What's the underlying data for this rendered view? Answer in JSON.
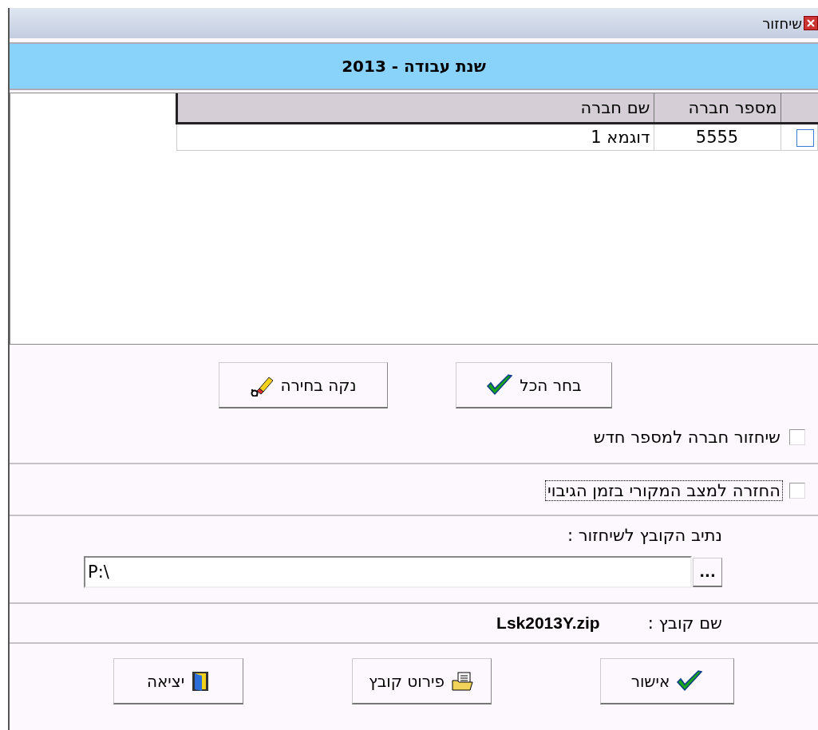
{
  "window": {
    "title": "שיחזור"
  },
  "header": {
    "title": "שנת עבודה - 2013"
  },
  "table": {
    "columns": [
      "מספר חברה",
      "שם חברה"
    ],
    "rows": [
      {
        "checked": false,
        "number": "5555",
        "name": "דוגמא 1"
      }
    ]
  },
  "selection_buttons": [
    {
      "kind": "select_all",
      "label": "בחר הכל"
    },
    {
      "kind": "clear",
      "label": "נקה בחירה"
    }
  ],
  "options": [
    {
      "label": "שיחזור חברה למספר חדש",
      "checked": false,
      "focused": false
    },
    {
      "label": "החזרה למצב המקורי בזמן הגיבוי",
      "checked": false,
      "focused": true
    }
  ],
  "path": {
    "label": "נתיב הקובץ לשיחזור :",
    "value": "P:\\",
    "browse_label": "..."
  },
  "file": {
    "label": "שם קובץ :",
    "value": "Lsk2013Y.zip"
  },
  "buttons": [
    {
      "kind": "confirm",
      "label": "אישור"
    },
    {
      "kind": "file_details",
      "label": "פירוט קובץ"
    },
    {
      "kind": "exit",
      "label": "יציאה"
    }
  ]
}
